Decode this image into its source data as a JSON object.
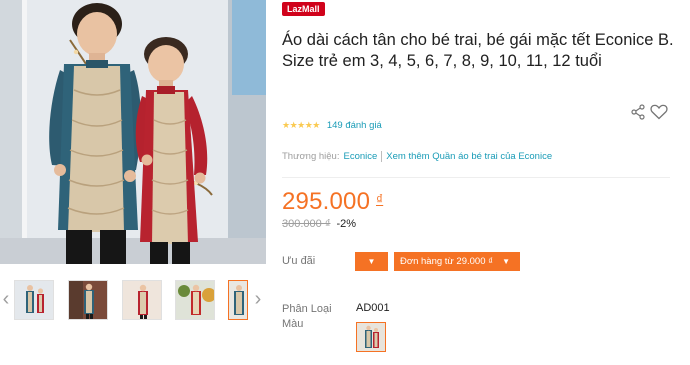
{
  "badge": "LazMall",
  "title": "Áo dài cách tân cho bé trai, bé gái mặc tết Econice B. Size trẻ em 3, 4, 5, 6, 7, 8, 9, 10, 11, 12 tuổi",
  "rating": {
    "stars": 4.5,
    "stars_text": "★★★★★",
    "review_text": "149 đánh giá"
  },
  "brand": {
    "label": "Thương hiệu:",
    "name": "Econice",
    "more_link": "Xem thêm Quần áo bé trai của Econice"
  },
  "price": {
    "current": "295.000",
    "currency": "₫",
    "original": "300.000 ₫",
    "discount": "-2%"
  },
  "promo": {
    "label": "Ưu đãi",
    "order_text": "Đơn hàng từ 29.000 ₫"
  },
  "variant": {
    "label": "Phân Loại Màu",
    "selected": "AD001"
  },
  "gallery": {
    "thumbnails": [
      "thumb-1",
      "thumb-2",
      "thumb-3",
      "thumb-4",
      "thumb-5"
    ]
  },
  "colors": {
    "accent": "#f57224",
    "link": "#1a9cb7",
    "badge": "#d0021b",
    "star": "#faca51"
  },
  "icons": [
    "share-icon",
    "heart-icon",
    "chevron-left-icon",
    "chevron-right-icon",
    "dropdown-caret-icon"
  ]
}
